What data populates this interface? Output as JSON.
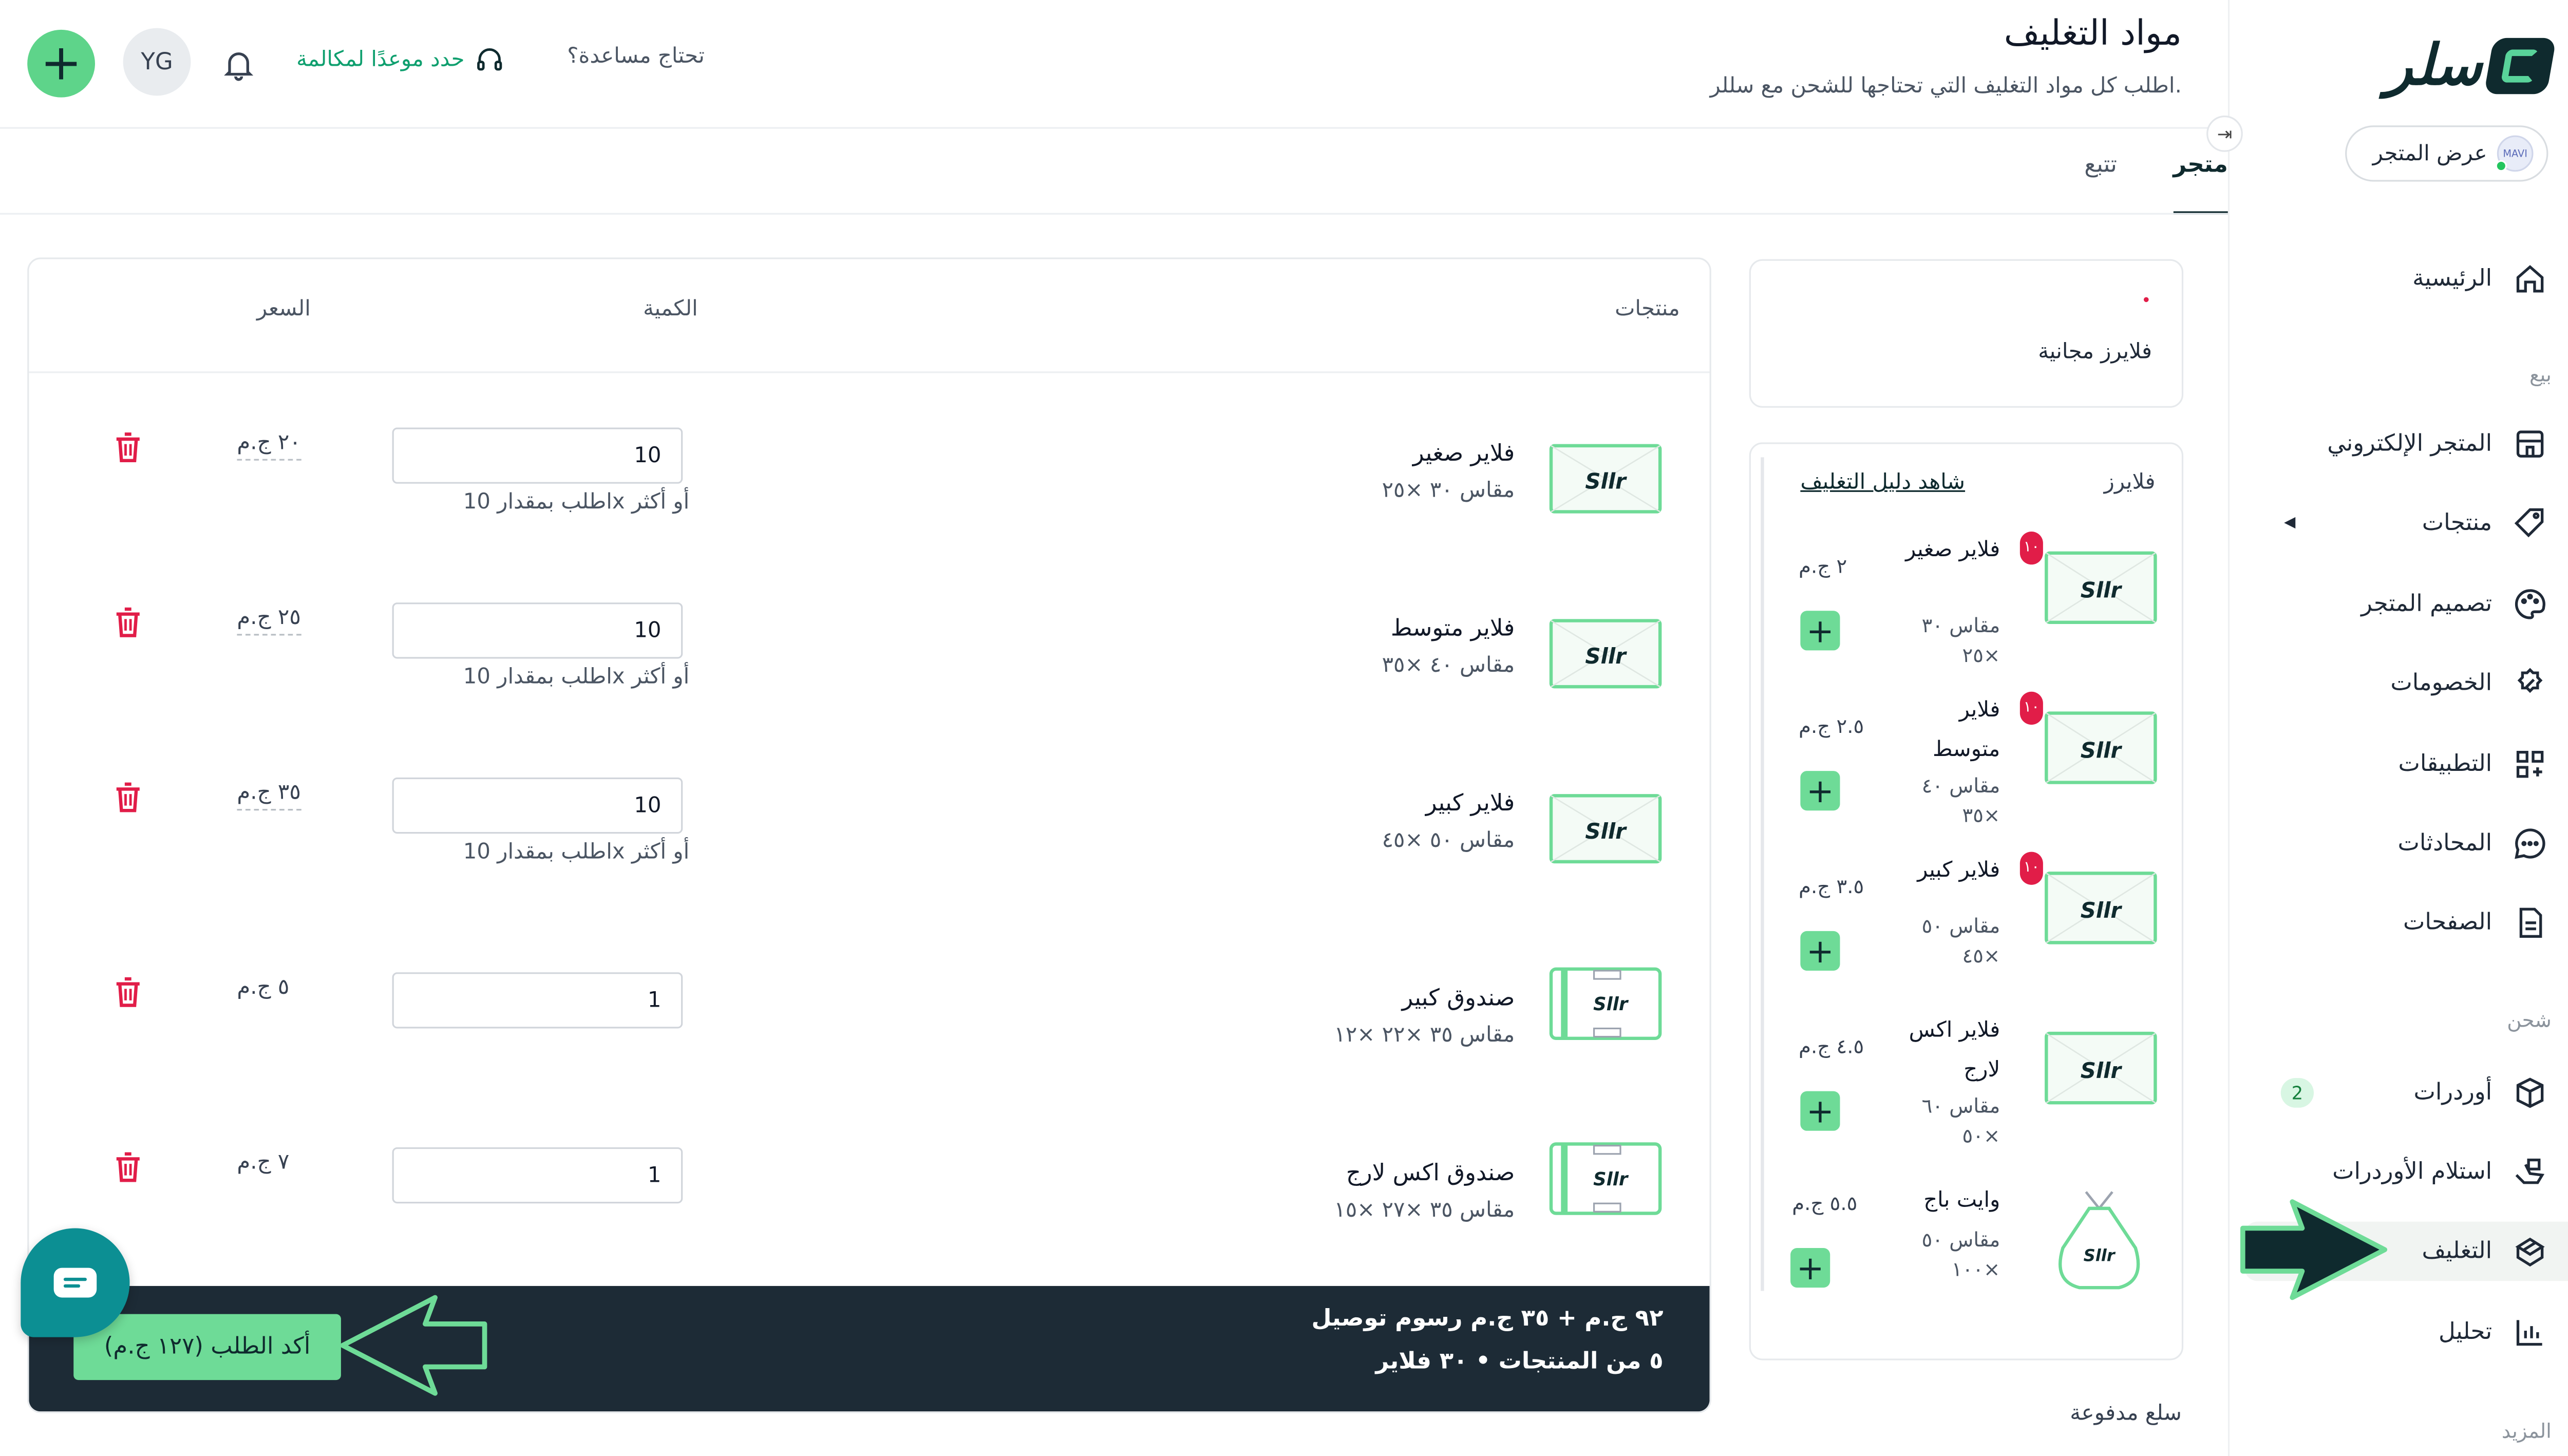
{
  "sidebar": {
    "logo_text": "سلر",
    "store_button": "عرض المتجر",
    "store_avatar_text": "MAVI",
    "items": [
      {
        "label": "الرئيسية",
        "icon": "home-icon"
      },
      {
        "section": "بيع"
      },
      {
        "label": "المتجر الإلكتروني",
        "icon": "store-icon"
      },
      {
        "label": "منتجات",
        "icon": "tag-icon"
      },
      {
        "label": "تصميم المتجر",
        "icon": "palette-icon"
      },
      {
        "label": "الخصومات",
        "icon": "discount-icon"
      },
      {
        "label": "التطبيقات",
        "icon": "apps-icon"
      },
      {
        "label": "المحادثات",
        "icon": "chat-icon"
      },
      {
        "label": "الصفحات",
        "icon": "page-icon"
      },
      {
        "section": "شحن"
      },
      {
        "label": "أوردرات",
        "icon": "box-icon",
        "badge": "2"
      },
      {
        "label": "استلام الأوردرات",
        "icon": "pickup-icon"
      },
      {
        "label": "التغليف",
        "icon": "package-icon",
        "active": true
      },
      {
        "label": "تحليل",
        "icon": "chart-icon"
      },
      {
        "section": "المزيد"
      }
    ]
  },
  "header": {
    "title": "مواد التغليف",
    "subtitle": "اطلب كل مواد التغليف التي تحتاجها للشحن مع سللر.",
    "help_text": "تحتاج مساعدة؟",
    "call_link": "حدد موعدًا لمكالمة",
    "avatar_initials": "YG",
    "add_symbol": "+"
  },
  "tabs": [
    {
      "label": "متجر",
      "active": true
    },
    {
      "label": "تتبع",
      "active": false
    }
  ],
  "catalog": {
    "free_label": "فلايرز مجانية",
    "category": "فلايرز",
    "guide_link": "شاهد دليل التغليف",
    "paid_label": "سلع مدفوعة",
    "items": [
      {
        "name": "فلاير صغير",
        "size": "مقاس ٣٠ ×٢٥",
        "price": "٢ ج.م",
        "badge": "١٠"
      },
      {
        "name": "فلاير متوسط",
        "size": "مقاس ٤٠ ×٣٥",
        "price": "٢.٥ ج.م",
        "badge": "١٠"
      },
      {
        "name": "فلاير كبير",
        "size": "مقاس ٥٠ ×٤٥",
        "price": "٣.٥ ج.م",
        "badge": "١٠"
      },
      {
        "name": "فلاير اكس لارج",
        "size": "مقاس ٦٠ ×٥٠",
        "price": "٤.٥ ج.م",
        "badge": ""
      },
      {
        "name": "وايت باج",
        "size": "مقاس ٥٠ ×١٠٠",
        "price": "٥.٥ ج.م",
        "badge": ""
      }
    ]
  },
  "cart": {
    "col_products": "منتجات",
    "col_quantity": "الكمية",
    "col_price": "السعر",
    "rows": [
      {
        "name": "فلاير صغير",
        "size": "مقاس ٣٠ ×٢٥",
        "qty": "10",
        "hint": "اطلب بمقدار 10x أو أكثر",
        "price": "٢٠ ج.م",
        "thumb": "flyer"
      },
      {
        "name": "فلاير متوسط",
        "size": "مقاس ٤٠ ×٣٥",
        "qty": "10",
        "hint": "اطلب بمقدار 10x أو أكثر",
        "price": "٢٥ ج.م",
        "thumb": "flyer"
      },
      {
        "name": "فلاير كبير",
        "size": "مقاس ٥٠ ×٤٥",
        "qty": "10",
        "hint": "اطلب بمقدار 10x أو أكثر",
        "price": "٣٥ ج.م",
        "thumb": "flyer"
      },
      {
        "name": "صندوق كبير",
        "size": "مقاس ٣٥ ×٢٢ ×١٢",
        "qty": "1",
        "hint": "",
        "price": "٥ ج.م",
        "thumb": "box"
      },
      {
        "name": "صندوق اكس لارج",
        "size": "مقاس ٣٥ ×٢٧ ×١٥",
        "qty": "1",
        "hint": "",
        "price": "٧ ج.م",
        "thumb": "box"
      }
    ],
    "summary_total": "٩٢ ج.م  + ٣٥ ج.م رسوم توصيل",
    "summary_counts": "٥ من المنتجات  •  ٣٠ فلاير",
    "confirm_button": "أكد الطلب (١٢٧ ج.م)"
  },
  "brand_text": "Sllr",
  "colors": {
    "accent": "#6edb97",
    "dark": "#1d2b36",
    "teal": "#0c8f93",
    "danger": "#e11d48"
  }
}
